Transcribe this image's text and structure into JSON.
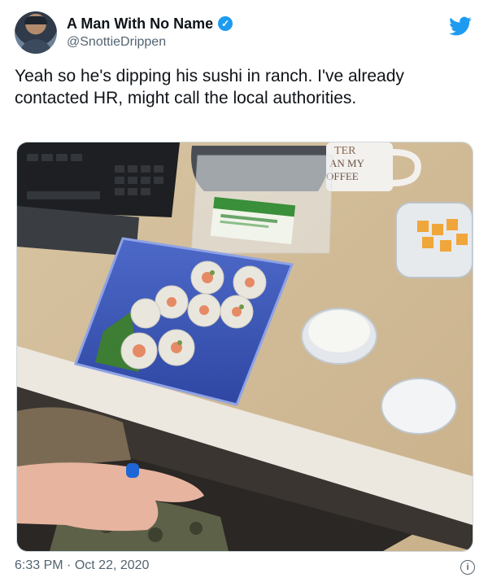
{
  "tweet": {
    "display_name": "A Man With No Name",
    "handle": "@SnottieDrippen",
    "text": "Yeah so he's dipping his sushi in ranch. I've already contacted HR, might call the local authorities.",
    "time": "6:33 PM",
    "separator": "·",
    "date": "Oct 22, 2020"
  },
  "photo": {
    "mug_text_line1": "TER",
    "mug_text_line2": "AN MY",
    "mug_text_line3": "OFFEE"
  },
  "icons": {
    "verified": "verified-badge-icon",
    "twitter": "twitter-bird-icon",
    "info": "info-icon"
  },
  "colors": {
    "accent": "#1d9bf0",
    "secondary_text": "#536471",
    "primary_text": "#0f1419"
  }
}
